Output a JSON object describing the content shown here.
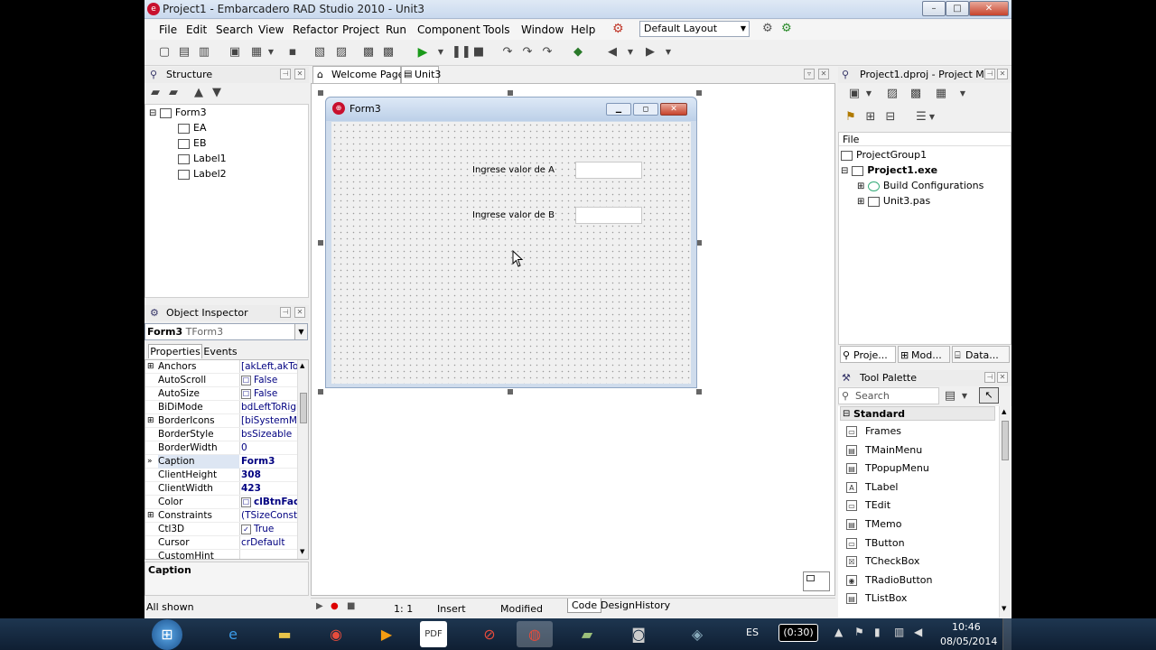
{
  "window": {
    "title": "Project1 - Embarcadero RAD Studio 2010 - Unit3",
    "minimize": "–",
    "maximize": "□",
    "close": "✕"
  },
  "menu": [
    "File",
    "Edit",
    "Search",
    "View",
    "Refactor",
    "Project",
    "Run",
    "Component",
    "Tools",
    "Window",
    "Help"
  ],
  "toolbar": {
    "layout": "Default Layout"
  },
  "structure": {
    "title": "Structure",
    "tree": [
      "Form3",
      "EA",
      "EB",
      "Label1",
      "Label2"
    ]
  },
  "object_inspector": {
    "title": "Object Inspector",
    "selected_name": "Form3",
    "selected_type": "TForm3",
    "tabs": [
      "Properties",
      "Events"
    ],
    "properties": [
      {
        "name": "Anchors",
        "value": "[akLeft,akTop]",
        "expand": "⊞"
      },
      {
        "name": "AutoScroll",
        "value": "False",
        "check": "☐"
      },
      {
        "name": "AutoSize",
        "value": "False",
        "check": "☐"
      },
      {
        "name": "BiDiMode",
        "value": "bdLeftToRight"
      },
      {
        "name": "BorderIcons",
        "value": "[biSystemMenu]",
        "expand": "⊞"
      },
      {
        "name": "BorderStyle",
        "value": "bsSizeable"
      },
      {
        "name": "BorderWidth",
        "value": "0"
      },
      {
        "name": "Caption",
        "value": "Form3",
        "bold": true,
        "marker": "»"
      },
      {
        "name": "ClientHeight",
        "value": "308",
        "bold": true
      },
      {
        "name": "ClientWidth",
        "value": "423",
        "bold": true
      },
      {
        "name": "Color",
        "value": "clBtnFace",
        "check": "☐",
        "bold": true
      },
      {
        "name": "Constraints",
        "value": "(TSizeConstraints)",
        "expand": "⊞"
      },
      {
        "name": "Ctl3D",
        "value": "True",
        "check": "✓"
      },
      {
        "name": "Cursor",
        "value": "crDefault"
      },
      {
        "name": "CustomHint",
        "value": ""
      }
    ],
    "description": "Caption",
    "status": "All shown"
  },
  "editor": {
    "tabs": [
      "Welcome Page",
      "Unit3"
    ],
    "status": {
      "position": "1:  1",
      "mode": "Insert",
      "state": "Modified"
    },
    "bottom_tabs": [
      "Code",
      "Design",
      "History"
    ]
  },
  "form": {
    "caption": "Form3",
    "label_a": "Ingrese valor de A",
    "label_b": "Ingrese valor de B"
  },
  "project_manager": {
    "title": "Project1.dproj - Project M...",
    "column": "File",
    "tree": [
      "ProjectGroup1",
      "Project1.exe",
      "Build Configurations",
      "Unit3.pas"
    ],
    "tabs": [
      "Proje...",
      "Mod...",
      "Data..."
    ]
  },
  "tool_palette": {
    "title": "Tool Palette",
    "search_placeholder": "Search",
    "category": "Standard",
    "items": [
      "Frames",
      "TMainMenu",
      "TPopupMenu",
      "TLabel",
      "TEdit",
      "TMemo",
      "TButton",
      "TCheckBox",
      "TRadioButton",
      "TListBox"
    ]
  },
  "taskbar": {
    "language": "ES",
    "battery": "0:30",
    "time": "10:46",
    "date": "08/05/2014"
  }
}
